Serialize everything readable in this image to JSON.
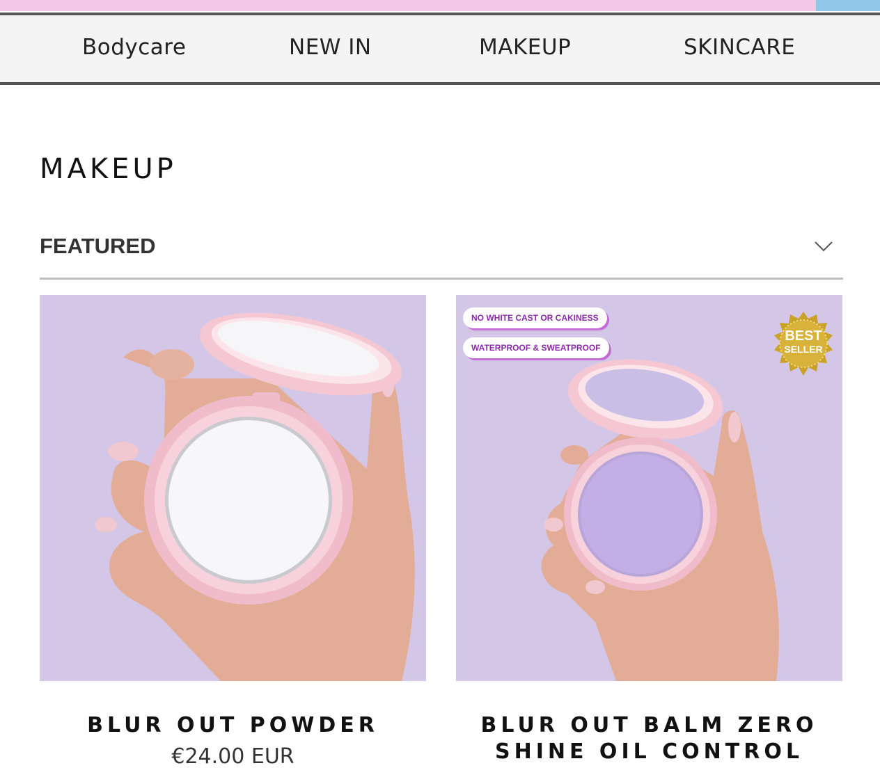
{
  "colors": {
    "announce_bar": "#f5c7e7",
    "accent": "#8fc6ea",
    "product_bg": "#d3c6e6",
    "compact_pink": "#f4c7d3",
    "powder_white": "#f7f7f9",
    "balm_lilac": "#c3aee6"
  },
  "nav": {
    "items": [
      "Bodycare",
      "NEW IN",
      "MAKEUP",
      "SKINCARE"
    ]
  },
  "page": {
    "title": "MAKEUP"
  },
  "sort": {
    "label": "FEATURED",
    "icon": "chevron-down-icon"
  },
  "products": [
    {
      "title": "BLUR OUT POWDER",
      "price": "€24.00 EUR",
      "image": "hand holding pink compact with white pressed powder"
    },
    {
      "title": "BLUR OUT BALM ZERO SHINE OIL CONTROL",
      "price": "",
      "image": "hand holding pink compact with lilac balm",
      "badges": [
        "NO WHITE CAST OR CAKINESS",
        "WATERPROOF & SWEATPROOF"
      ],
      "seal": {
        "line1": "BEST",
        "line2": "SELLER"
      }
    }
  ]
}
